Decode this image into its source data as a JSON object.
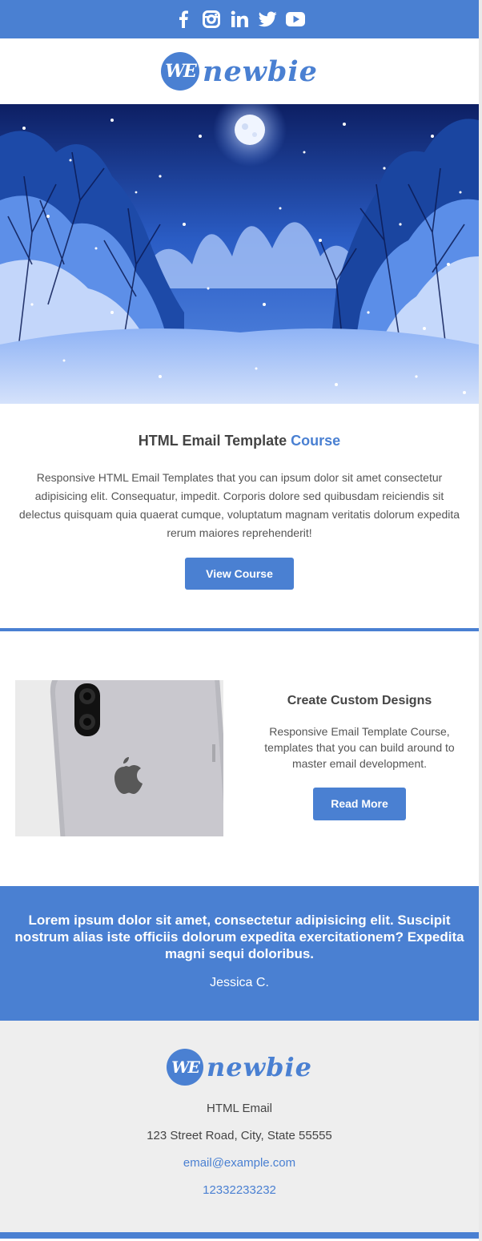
{
  "social": {
    "icons": [
      "facebook-icon",
      "instagram-icon",
      "linkedin-icon",
      "twitter-icon",
      "youtube-icon"
    ],
    "bar_color": "#4a80d2"
  },
  "brand": {
    "badge": "WE",
    "name": "newbie",
    "color": "#4a80d2"
  },
  "course": {
    "title_main": "HTML Email Template ",
    "title_accent": "Course",
    "body": "Responsive HTML Email Templates that you can ipsum dolor sit amet consectetur adipisicing elit. Consequatur, impedit. Corporis dolore sed quibusdam reiciendis sit delectus quisquam quia quaerat cumque, voluptatum magnam veritatis dolorum expedita rerum maiores reprehenderit!",
    "button": "View Course"
  },
  "feature": {
    "title": "Create Custom Designs",
    "body": "Responsive Email Template Course, templates that you can build around to master email development.",
    "button": "Read More"
  },
  "testimonial": {
    "quote": "Lorem ipsum dolor sit amet, consectetur adipisicing elit. Suscipit nostrum alias iste officiis dolorum expedita exercitationem? Expedita magni sequi doloribus.",
    "author": "Jessica C."
  },
  "footer": {
    "company": "HTML Email",
    "address": "123 Street Road, City, State 55555",
    "email": "email@example.com",
    "phone": "12332233232"
  }
}
